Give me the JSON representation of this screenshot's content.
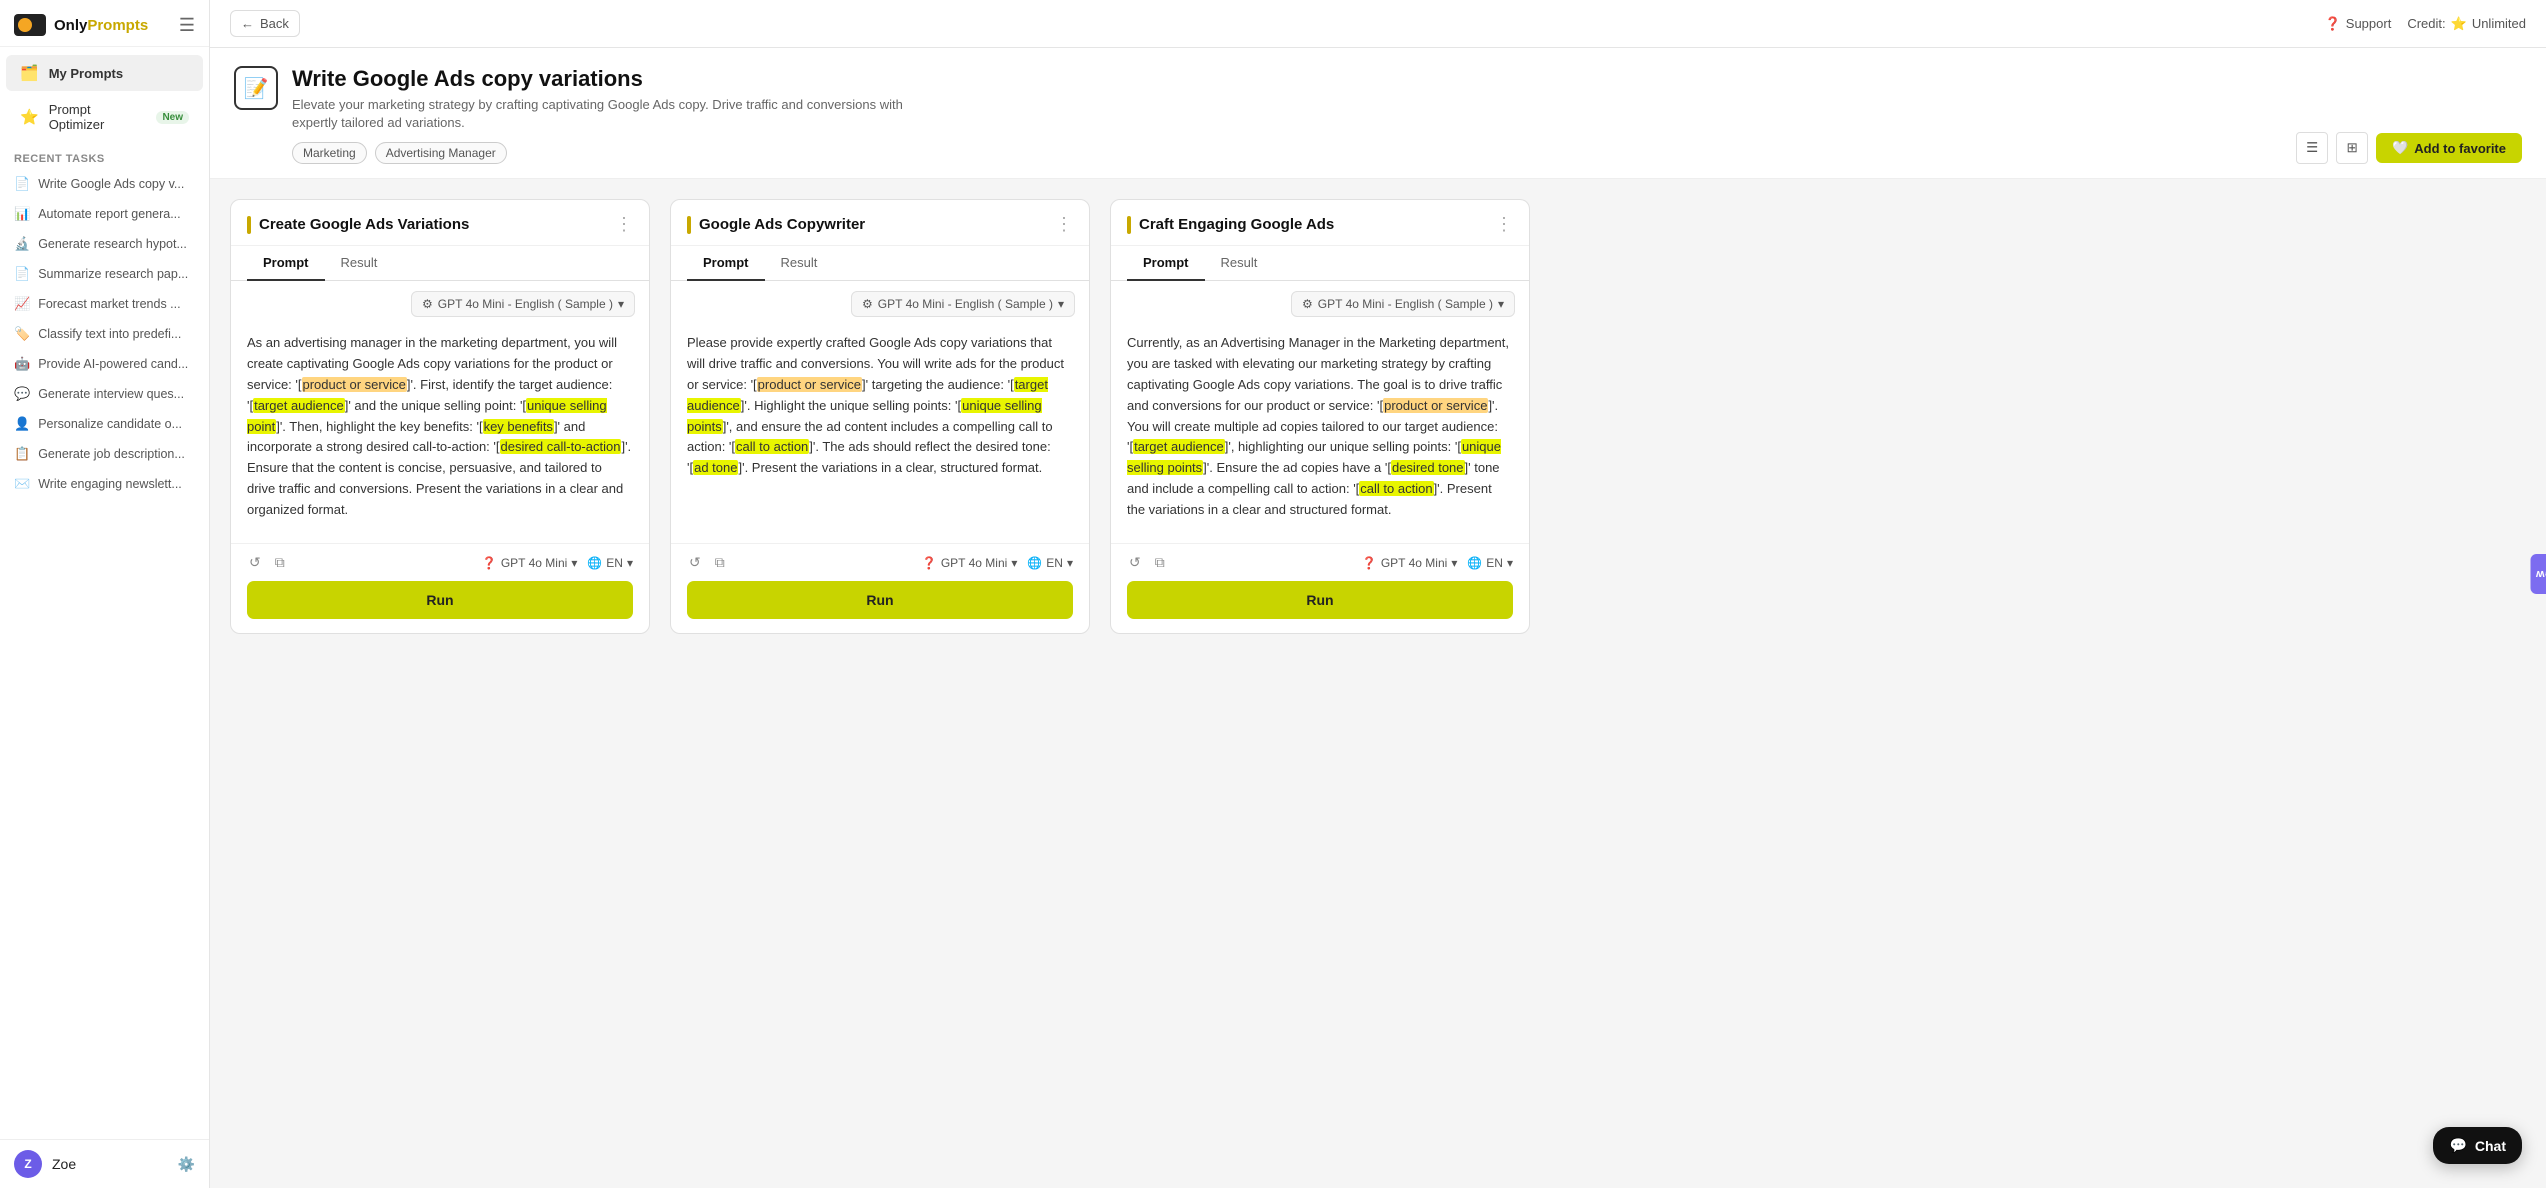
{
  "app": {
    "name": "Only",
    "name_highlight": "Prompts"
  },
  "topbar": {
    "back_label": "Back",
    "support_label": "Support",
    "credit_label": "Credit:",
    "credit_value": "Unlimited"
  },
  "sidebar": {
    "nav_items": [
      {
        "id": "my-prompts",
        "label": "My Prompts",
        "icon": "🗂️",
        "active": true
      },
      {
        "id": "prompt-optimizer",
        "label": "Prompt Optimizer",
        "icon": "⭐",
        "badge": "New"
      }
    ],
    "recent_section_label": "Recent Tasks",
    "recent_items": [
      {
        "id": "r1",
        "label": "Write Google Ads copy v...",
        "icon": "📄"
      },
      {
        "id": "r2",
        "label": "Automate report genera...",
        "icon": "📊"
      },
      {
        "id": "r3",
        "label": "Generate research hypot...",
        "icon": "🔬"
      },
      {
        "id": "r4",
        "label": "Summarize research pap...",
        "icon": "📄"
      },
      {
        "id": "r5",
        "label": "Forecast market trends ...",
        "icon": "📈"
      },
      {
        "id": "r6",
        "label": "Classify text into predefi...",
        "icon": "🏷️"
      },
      {
        "id": "r7",
        "label": "Provide AI-powered cand...",
        "icon": "🤖"
      },
      {
        "id": "r8",
        "label": "Generate interview ques...",
        "icon": "💬"
      },
      {
        "id": "r9",
        "label": "Personalize candidate o...",
        "icon": "👤"
      },
      {
        "id": "r10",
        "label": "Generate job description...",
        "icon": "📋"
      },
      {
        "id": "r11",
        "label": "Write engaging newslett...",
        "icon": "✉️"
      }
    ],
    "user_name": "Zoe"
  },
  "page": {
    "title": "Write Google Ads copy variations",
    "subtitle": "Elevate your marketing strategy by crafting captivating Google Ads copy. Drive traffic and conversions with expertly tailored ad variations.",
    "tags": [
      "Marketing",
      "Advertising Manager"
    ],
    "add_favorite_label": "Add to favorite"
  },
  "cards": [
    {
      "id": "card1",
      "title": "Create Google Ads Variations",
      "accent_color": "#c8a800",
      "active_tab": "Prompt",
      "tabs": [
        "Prompt",
        "Result"
      ],
      "model": "GPT 4o Mini - English ( Sample )",
      "prompt_text_parts": [
        {
          "type": "text",
          "content": "As an advertising manager in the marketing department, you will create captivating Google Ads copy variations for the product or service: '["
        },
        {
          "type": "highlight-orange",
          "content": "product or service"
        },
        {
          "type": "text",
          "content": "]'. First, identify the target audience: '["
        },
        {
          "type": "highlight-yellow",
          "content": "target audience"
        },
        {
          "type": "text",
          "content": "]' and the unique selling point: '["
        },
        {
          "type": "highlight-yellow",
          "content": "unique selling point"
        },
        {
          "type": "text",
          "content": "]'. Then, highlight the key benefits: '["
        },
        {
          "type": "highlight-yellow",
          "content": "key benefits"
        },
        {
          "type": "text",
          "content": "]' and incorporate a strong desired call-to-action: '["
        },
        {
          "type": "highlight-yellow",
          "content": "desired call-to-action"
        },
        {
          "type": "text",
          "content": "]'. Ensure that the content is concise, persuasive, and tailored to drive traffic and conversions. Present the variations in a clear and organized format."
        }
      ],
      "footer_model": "GPT 4o Mini",
      "footer_lang": "EN",
      "run_label": "Run"
    },
    {
      "id": "card2",
      "title": "Google Ads Copywriter",
      "accent_color": "#c8a800",
      "active_tab": "Prompt",
      "tabs": [
        "Prompt",
        "Result"
      ],
      "model": "GPT 4o Mini - English ( Sample )",
      "prompt_text_parts": [
        {
          "type": "text",
          "content": "Please provide expertly crafted Google Ads copy variations that will drive traffic and conversions. You will write ads for the product or service: '["
        },
        {
          "type": "highlight-orange",
          "content": "product or service"
        },
        {
          "type": "text",
          "content": "]' targeting the audience: '["
        },
        {
          "type": "highlight-yellow",
          "content": "target audience"
        },
        {
          "type": "text",
          "content": "]'. Highlight the unique selling points: '["
        },
        {
          "type": "highlight-yellow",
          "content": "unique selling points"
        },
        {
          "type": "text",
          "content": "]', and ensure the ad content includes a compelling call to action: '["
        },
        {
          "type": "highlight-yellow",
          "content": "call to action"
        },
        {
          "type": "text",
          "content": "]'. The ads should reflect the desired tone: '["
        },
        {
          "type": "highlight-yellow",
          "content": "ad tone"
        },
        {
          "type": "text",
          "content": "]'. Present the variations in a clear, structured format."
        }
      ],
      "footer_model": "GPT 4o Mini",
      "footer_lang": "EN",
      "run_label": "Run"
    },
    {
      "id": "card3",
      "title": "Craft Engaging Google Ads",
      "accent_color": "#c8a800",
      "active_tab": "Prompt",
      "tabs": [
        "Prompt",
        "Result"
      ],
      "model": "GPT 4o Mini - English ( Sample )",
      "prompt_text_parts": [
        {
          "type": "text",
          "content": "Currently, as an Advertising Manager in the Marketing department, you are tasked with elevating our marketing strategy by crafting captivating Google Ads copy variations. The goal is to drive traffic and conversions for our product or service: '["
        },
        {
          "type": "highlight-orange",
          "content": "product or service"
        },
        {
          "type": "text",
          "content": "]'. You will create multiple ad copies tailored to our target audience: '["
        },
        {
          "type": "highlight-yellow",
          "content": "target audience"
        },
        {
          "type": "text",
          "content": "]', highlighting our unique selling points: '["
        },
        {
          "type": "highlight-yellow",
          "content": "unique selling points"
        },
        {
          "type": "text",
          "content": "]'. Ensure the ad copies have a '["
        },
        {
          "type": "highlight-yellow",
          "content": "desired tone"
        },
        {
          "type": "text",
          "content": "]' tone and include a compelling call to action: '["
        },
        {
          "type": "highlight-yellow",
          "content": "call to action"
        },
        {
          "type": "text",
          "content": "]'. Present the variations in a clear and structured format."
        }
      ],
      "footer_model": "GPT 4o Mini",
      "footer_lang": "EN",
      "run_label": "Run"
    }
  ],
  "whats_new_label": "What's new",
  "chat_label": "Chat"
}
